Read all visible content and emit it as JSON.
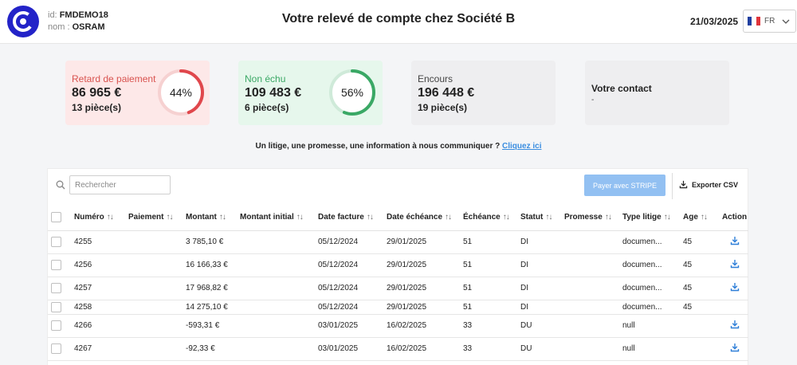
{
  "header": {
    "id_label": "id:",
    "id_value": "FMDEMO18",
    "name_label": "nom :",
    "name_value": "OSRAM",
    "title": "Votre relevé de compte chez Société B",
    "date": "21/03/2025",
    "lang": "FR"
  },
  "cards": {
    "late": {
      "label": "Retard de paiement",
      "amount": "86 965 €",
      "count": "13 pièce(s)",
      "percent_text": "44%",
      "percent": 44,
      "color": "#e0474c"
    },
    "ok": {
      "label": "Non échu",
      "amount": "109 483 €",
      "count": "6 pièce(s)",
      "percent_text": "56%",
      "percent": 56,
      "color": "#3aa865"
    },
    "outstanding": {
      "label": "Encours",
      "amount": "196 448 €",
      "count": "19 pièce(s)"
    },
    "contact": {
      "title": "Votre contact",
      "value": "-"
    }
  },
  "dispute": {
    "text": "Un litige, une promesse, une information à nous communiquer ?",
    "link": "Cliquez ici"
  },
  "toolbar": {
    "search_placeholder": "Rechercher",
    "stripe_label": "Payer avec STRIPE",
    "csv_label": "Exporter CSV"
  },
  "table": {
    "sort_glyph": "↑↓",
    "columns": [
      "Numéro",
      "Paiement",
      "Montant",
      "Montant initial",
      "Date facture",
      "Date échéance",
      "Échéance",
      "Statut",
      "Promesse",
      "Type litige",
      "Age",
      "Action"
    ],
    "rows": [
      {
        "numero": "4255",
        "paiement": "",
        "montant": "3 785,10 €",
        "montant_initial": "",
        "date_facture": "05/12/2024",
        "date_echeance": "29/01/2025",
        "echeance": "51",
        "statut": "DI",
        "promesse": "",
        "type_litige": "documen...",
        "age": "45",
        "download": true
      },
      {
        "numero": "4256",
        "paiement": "",
        "montant": "16 166,33 €",
        "montant_initial": "",
        "date_facture": "05/12/2024",
        "date_echeance": "29/01/2025",
        "echeance": "51",
        "statut": "DI",
        "promesse": "",
        "type_litige": "documen...",
        "age": "45",
        "download": true
      },
      {
        "numero": "4257",
        "paiement": "",
        "montant": "17 968,82 €",
        "montant_initial": "",
        "date_facture": "05/12/2024",
        "date_echeance": "29/01/2025",
        "echeance": "51",
        "statut": "DI",
        "promesse": "",
        "type_litige": "documen...",
        "age": "45",
        "download": true
      },
      {
        "numero": "4258",
        "paiement": "",
        "montant": "14 275,10 €",
        "montant_initial": "",
        "date_facture": "05/12/2024",
        "date_echeance": "29/01/2025",
        "echeance": "51",
        "statut": "DI",
        "promesse": "",
        "type_litige": "documen...",
        "age": "45",
        "download": false
      },
      {
        "numero": "4266",
        "paiement": "",
        "montant": "-593,31 €",
        "montant_initial": "",
        "date_facture": "03/01/2025",
        "date_echeance": "16/02/2025",
        "echeance": "33",
        "statut": "DU",
        "promesse": "",
        "type_litige": "null",
        "age": "",
        "download": true
      },
      {
        "numero": "4267",
        "paiement": "",
        "montant": "-92,33 €",
        "montant_initial": "",
        "date_facture": "03/01/2025",
        "date_echeance": "16/02/2025",
        "echeance": "33",
        "statut": "DU",
        "promesse": "",
        "type_litige": "null",
        "age": "",
        "download": true
      }
    ]
  },
  "icons": {
    "logo": "company-logo",
    "search": "search-icon",
    "download": "download-icon",
    "flag": "flag-fr-icon",
    "chevron": "chevron-down-icon"
  },
  "colors": {
    "brand": "#2323c8",
    "link": "#3a8de0",
    "stripe": "#92c0f2",
    "download": "#2f7fd8"
  }
}
